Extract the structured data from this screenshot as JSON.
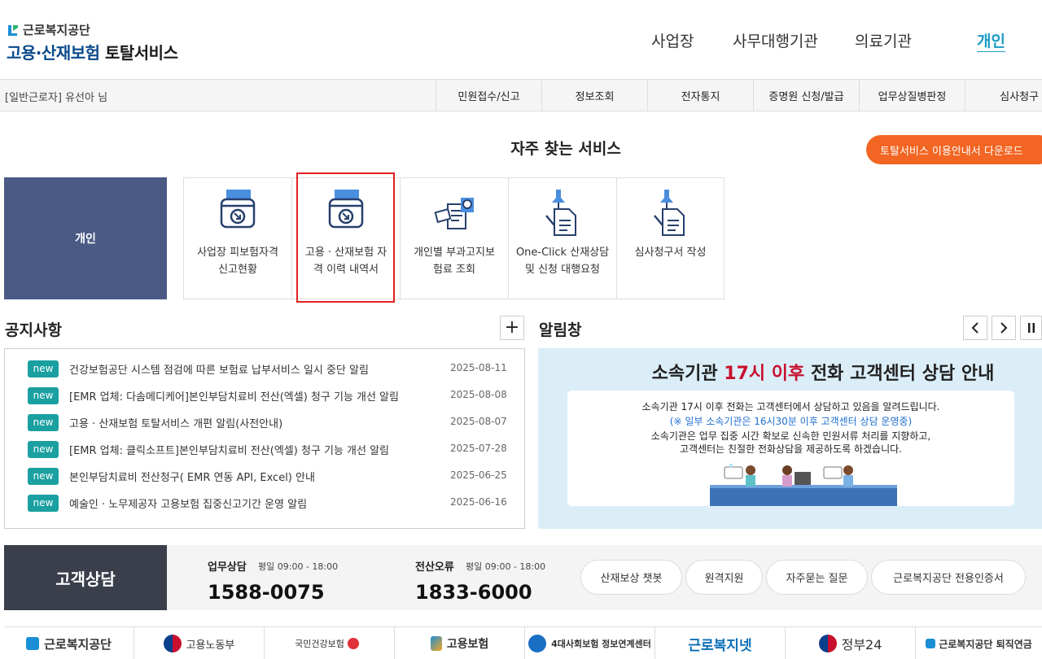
{
  "header": {
    "org_name": "근로복지공단",
    "service_name_part1": "고용·산재보험",
    "service_name_part2": "토탈서비스",
    "nav": [
      {
        "label": "사업장"
      },
      {
        "label": "사무대행기관"
      },
      {
        "label": "의료기관"
      },
      {
        "label": "개인",
        "active": true
      }
    ]
  },
  "subbar": {
    "user_type": "[일반근로자]",
    "user_name": "유선아",
    "honorific": "님",
    "menu": [
      "민원접수/신고",
      "정보조회",
      "전자통지",
      "증명원 신청/발급",
      "업무상질병판정",
      "심사청구"
    ]
  },
  "frequent": {
    "title": "자주 찾는 서비스",
    "guide_button": "토탈서비스 이용안내서 다운로드",
    "category": "개인",
    "services": [
      {
        "line1": "사업장 피보험자격",
        "line2": "신고현황",
        "icon": "inbox-download-icon"
      },
      {
        "line1": "고용 · 산재보험 자",
        "line2": "격 이력 내역서",
        "icon": "inbox-download-icon"
      },
      {
        "line1": "개인별 부과고지보",
        "line2": "험료 조회",
        "icon": "document-search-icon"
      },
      {
        "line1": "One-Click 산재상담",
        "line2": "및 신청 대행요청",
        "icon": "document-pin-icon"
      },
      {
        "line1": "심사청구서 작성",
        "line2": "",
        "icon": "document-pin-icon"
      }
    ]
  },
  "notices": {
    "title": "공지사항",
    "more_label": "+",
    "badge": "new",
    "items": [
      {
        "text": "건강보험공단 시스템 점검에 따른 보험료 납부서비스 일시 중단 알림",
        "date": "2025-08-11"
      },
      {
        "text": "[EMR 업체: 다솜메디케어]본인부담치료비 전산(엑셀) 청구 기능 개선 알림",
        "date": "2025-08-08"
      },
      {
        "text": "고용 · 산재보험 토탈서비스 개편 알림(사전안내)",
        "date": "2025-08-07"
      },
      {
        "text": "[EMR 업체: 클릭소프트]본인부담치료비 전산(엑셀) 청구 기능 개선 알림",
        "date": "2025-07-28"
      },
      {
        "text": "본인부담치료비 전산청구( EMR 연동 API, Excel) 안내",
        "date": "2025-06-25"
      },
      {
        "text": "예술인 · 노무제공자 고용보험 집중신고기간 운영 알림",
        "date": "2025-06-16"
      }
    ]
  },
  "alarm": {
    "title": "알림창",
    "headline_pre": "소속기관 ",
    "headline_red": "17시 이후",
    "headline_post": " 전화 고객센터 상담 안내",
    "lines": [
      "소속기관 17시 이후 전화는 고객센터에서 상담하고 있음을 알려드립니다.",
      "(※ 일부 소속기관은 16시30분 이후 고객센터 상담 운영중)",
      "소속기관은 업무 집중 시간 확보로 신속한 민원서류 처리를 지향하고,",
      "고객센터는 친절한 전화상담을 제공하도록 하겠습니다."
    ],
    "colors": {
      "red": "#c8102e",
      "blue": "#1f6fd1"
    }
  },
  "customer": {
    "title": "고객상담",
    "work": {
      "label": "업무상담",
      "hours": "평일 09:00 - 18:00",
      "phone": "1588-0075"
    },
    "it": {
      "label": "전산오류",
      "hours": "평일 09:00 - 18:00",
      "phone": "1833-6000"
    },
    "buttons": [
      "산재보상 챗봇",
      "원격지원",
      "자주묻는 질문",
      "근로복지공단 전용인증서"
    ]
  },
  "footer": {
    "logos": [
      "근로복지공단",
      "고용노동부",
      "국민건강보험",
      "고용보험",
      "4대사회보험 정보연계센터",
      "근로복지넷",
      "정부24",
      "근로복지공단 퇴직연금"
    ]
  },
  "colors": {
    "accent_orange": "#f26522",
    "brand_blue": "#0a4a8c",
    "new_badge": "#1aa0a0",
    "active_nav": "#1a9bc4"
  }
}
